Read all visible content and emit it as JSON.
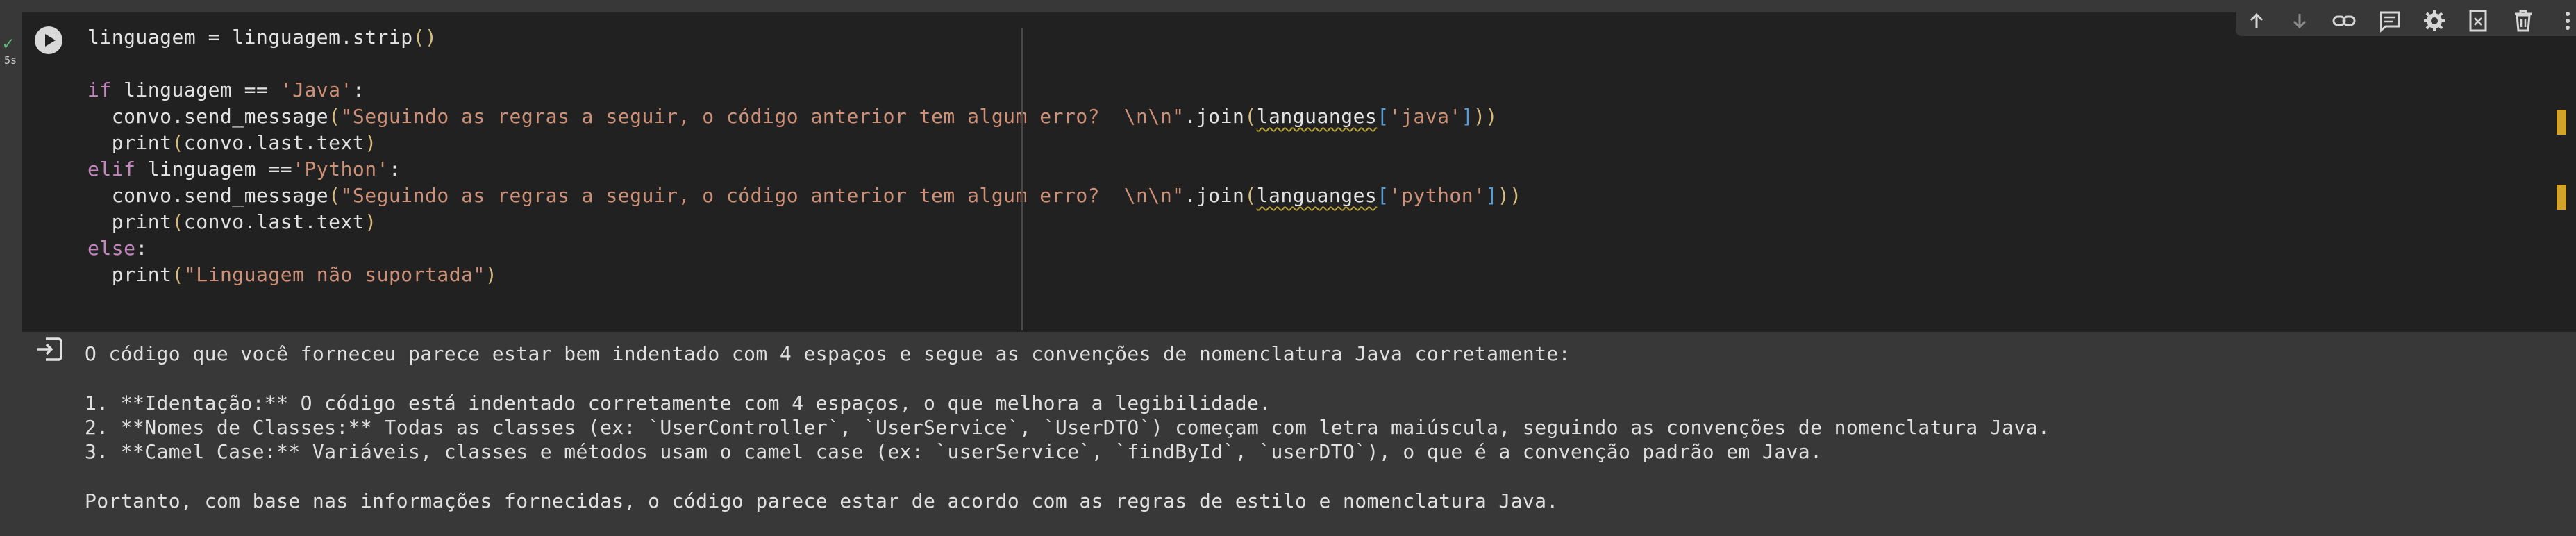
{
  "execution": {
    "status_icon": "check-icon",
    "time": "5s"
  },
  "code": {
    "lines": [
      {
        "segments": [
          {
            "t": "linguagem = linguagem.strip"
          },
          {
            "t": "()",
            "c": "paren"
          }
        ]
      },
      {
        "segments": []
      },
      {
        "segments": [
          {
            "t": "if",
            "c": "kw"
          },
          {
            "t": " linguagem == "
          },
          {
            "t": "'Java'",
            "c": "str"
          },
          {
            "t": ":"
          }
        ]
      },
      {
        "segments": [
          {
            "t": "  convo.send_message"
          },
          {
            "t": "(",
            "c": "paren"
          },
          {
            "t": "\"Seguindo as regras a seguir, o código anterior tem algum erro?  \\n\\n\"",
            "c": "str"
          },
          {
            "t": ".join"
          },
          {
            "t": "(",
            "c": "paren"
          },
          {
            "t": "languanges",
            "c": "warn"
          },
          {
            "t": "[",
            "c": "brk"
          },
          {
            "t": "'java'",
            "c": "str"
          },
          {
            "t": "]",
            "c": "brk"
          },
          {
            "t": "))",
            "c": "paren"
          }
        ]
      },
      {
        "segments": [
          {
            "t": "  print"
          },
          {
            "t": "(",
            "c": "paren"
          },
          {
            "t": "convo.last.text"
          },
          {
            "t": ")",
            "c": "paren"
          }
        ]
      },
      {
        "segments": [
          {
            "t": "elif",
            "c": "kw"
          },
          {
            "t": " linguagem =="
          },
          {
            "t": "'Python'",
            "c": "str"
          },
          {
            "t": ":"
          }
        ]
      },
      {
        "segments": [
          {
            "t": "  convo.send_message"
          },
          {
            "t": "(",
            "c": "paren"
          },
          {
            "t": "\"Seguindo as regras a seguir, o código anterior tem algum erro?  \\n\\n\"",
            "c": "str"
          },
          {
            "t": ".join"
          },
          {
            "t": "(",
            "c": "paren"
          },
          {
            "t": "languanges",
            "c": "warn"
          },
          {
            "t": "[",
            "c": "brk"
          },
          {
            "t": "'python'",
            "c": "str"
          },
          {
            "t": "]",
            "c": "brk"
          },
          {
            "t": "))",
            "c": "paren"
          }
        ]
      },
      {
        "segments": [
          {
            "t": "  print"
          },
          {
            "t": "(",
            "c": "paren"
          },
          {
            "t": "convo.last.text"
          },
          {
            "t": ")",
            "c": "paren"
          }
        ]
      },
      {
        "segments": [
          {
            "t": "else",
            "c": "kw"
          },
          {
            "t": ":"
          }
        ]
      },
      {
        "segments": [
          {
            "t": "  print"
          },
          {
            "t": "(",
            "c": "paren"
          },
          {
            "t": "\"Linguagem não suportada\"",
            "c": "str"
          },
          {
            "t": ")",
            "c": "paren"
          }
        ]
      }
    ]
  },
  "toolbar": {
    "items": [
      {
        "name": "move-up-icon"
      },
      {
        "name": "move-down-icon"
      },
      {
        "name": "link-icon"
      },
      {
        "name": "comment-icon"
      },
      {
        "name": "settings-icon"
      },
      {
        "name": "mirror-cell-icon"
      },
      {
        "name": "delete-icon"
      },
      {
        "name": "more-icon"
      }
    ]
  },
  "output": {
    "icon": "output-icon",
    "lines": [
      "O código que você forneceu parece estar bem indentado com 4 espaços e segue as convenções de nomenclatura Java corretamente:",
      "",
      "1. **Identação:** O código está indentado corretamente com 4 espaços, o que melhora a legibilidade.",
      "2. **Nomes de Classes:** Todas as classes (ex: `UserController`, `UserService`, `UserDTO`) começam com letra maiúscula, seguindo as convenções de nomenclatura Java.",
      "3. **Camel Case:** Variáveis, classes e métodos usam o camel case (ex: `userService`, `findById`, `userDTO`), o que é a convenção padrão em Java.",
      "",
      "Portanto, com base nas informações fornecidas, o código parece estar de acordo com as regras de estilo e nomenclatura Java."
    ]
  }
}
